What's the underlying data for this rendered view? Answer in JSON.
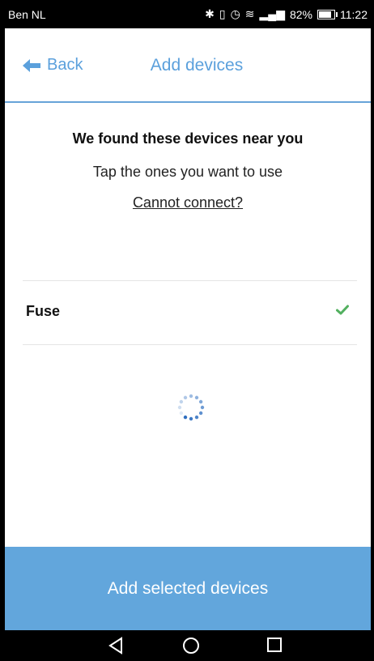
{
  "status_bar": {
    "carrier": "Ben NL",
    "battery_text": "82%",
    "time": "11:22",
    "battery_level": 0.82
  },
  "header": {
    "back_label": "Back",
    "title": "Add devices",
    "accent_color": "#5ba0dc"
  },
  "main": {
    "heading": "We found these devices near you",
    "subheading": "Tap the ones you want to use",
    "help_link": "Cannot connect?"
  },
  "devices": [
    {
      "name": "Fuse",
      "selected": true
    }
  ],
  "footer": {
    "button_label": "Add selected devices",
    "button_color": "#62a6dc"
  },
  "icons": {
    "back": "arrow-left-icon",
    "check": "check-icon",
    "spinner": "loading-spinner-icon",
    "nav_back": "triangle-back-icon",
    "nav_home": "circle-home-icon",
    "nav_recents": "square-recents-icon"
  }
}
